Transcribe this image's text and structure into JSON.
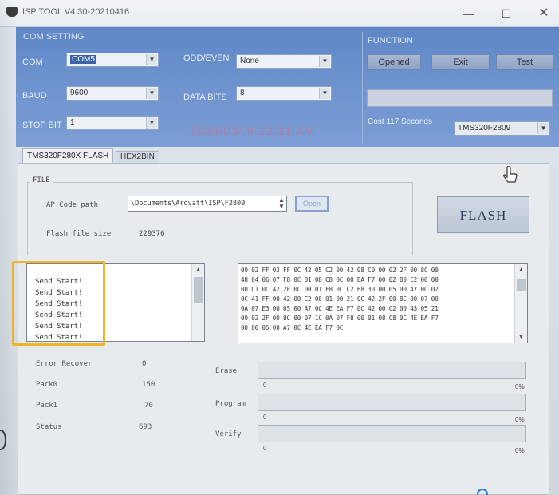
{
  "window": {
    "title": "ISP TOOL V4.30-20210416",
    "min_glyph": "—",
    "max_glyph": "☐",
    "close_glyph": "✕"
  },
  "com_setting": {
    "group_label": "COM SETTING",
    "com_label": "COM",
    "com_value": "COM5",
    "baud_label": "BAUD",
    "baud_value": "9600",
    "stop_bit_label": "STOP BIT",
    "stop_bit_value": "1",
    "odd_even_label": "ODD/EVEN",
    "odd_even_value": "None",
    "data_bits_label": "DATA BITS",
    "data_bits_value": "8"
  },
  "function": {
    "group_label": "FUNCTION",
    "opened_label": "Opened",
    "exit_label": "Exit",
    "test_label": "Test",
    "cost_text": "Cost 117 Seconds",
    "chip_value": "TMS320F2809"
  },
  "watermark": "2024/03/  9:22:31  AM",
  "tabs": [
    {
      "label": "TMS320F280X FLASH"
    },
    {
      "label": "HEX2BIN"
    }
  ],
  "file": {
    "legend": "FILE",
    "ap_code_label": "AP Code path",
    "ap_code_path": "\\Documents\\Arovatt\\ISP\\F2809",
    "open_label": "Open",
    "flash_size_label": "Flash file size",
    "flash_size_value": "229376"
  },
  "flash_button_label": "FLASH",
  "log_lines": [
    "Send  Start!",
    "Send  Start!",
    "Send  Start!",
    "Send  Start!",
    "Send  Start!",
    "Send  Start!"
  ],
  "hex_lines": [
    "00 02 FF 03 FF 0C 42 05 C2 00 42 08 C0 00 02 2F 00 8C 00",
    "48 04 06 07 F8 0C 01 08 C8 0C 00 EA F7 00 02 B0 C2 00 00",
    "00 C1 0C 42 2F 0C 00 01 F8 0C C2 68 30 00 05 00 A7 0C 02",
    "0C 41 FF 00 42 00 C2 00 01 00 21 0C 42 2F 00 8C 00 07 00",
    "0A 07 E3 00 05 00 A7 0C 4E EA F7 0C 42 00 C2 00 43 05 21",
    "00 02 2F 00 8C 00 07 1C 0A 07 F8 00 01 08 C8 0C 4E EA F7",
    "00 00 05 00 A7 0C 4E EA F7 0C"
  ],
  "stats": {
    "error_recover_label": "Error Recover",
    "error_recover_value": "0",
    "pack0_label": "Pack0",
    "pack0_value": "150",
    "pack1_label": "Pack1",
    "pack1_value": "70",
    "status_label": "Status",
    "status_value": "693"
  },
  "progress": {
    "erase_label": "Erase",
    "program_label": "Program",
    "verify_label": "Verify",
    "scale_min": "0",
    "scale_max": "0%"
  },
  "colors": {
    "panel_blue": "#6e93cf",
    "highlight": "#f0b429"
  }
}
